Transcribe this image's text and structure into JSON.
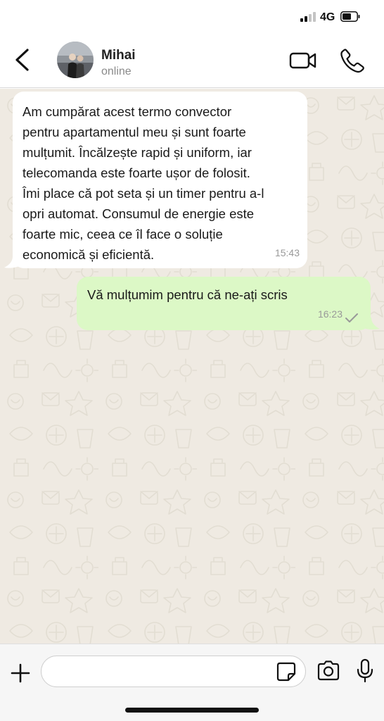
{
  "status_bar": {
    "network": "4G",
    "signal_icon": "cellular-signal-icon",
    "battery_icon": "battery-icon"
  },
  "header": {
    "back_icon": "chevron-left-icon",
    "contact_name": "Mihai",
    "contact_status": "online",
    "video_icon": "video-camera-icon",
    "call_icon": "phone-icon"
  },
  "messages": [
    {
      "direction": "incoming",
      "lines": [
        "Am cumpărat acest termo convector",
        "pentru apartamentul meu și sunt foarte",
        "mulțumit. Încălzește rapid și uniform, iar",
        "telecomanda este foarte ușor de folosit.",
        "Îmi place că pot seta și un timer pentru a-l",
        "opri automat. Consumul de energie este",
        "foarte mic, ceea ce îl face o soluție",
        "economică și eficientă."
      ],
      "time": "15:43"
    },
    {
      "direction": "outgoing",
      "lines": [
        "Vă mulțumim pentru că ne-ați scris"
      ],
      "time": "16:23",
      "status_icon": "check-icon"
    }
  ],
  "input_bar": {
    "plus_icon": "plus-icon",
    "message_value": "",
    "sticker_icon": "sticker-icon",
    "camera_icon": "camera-icon",
    "mic_icon": "microphone-icon"
  },
  "colors": {
    "chat_background": "#efeae2",
    "incoming_bubble": "#ffffff",
    "outgoing_bubble": "#dcf8c6",
    "timestamp": "#999999"
  }
}
